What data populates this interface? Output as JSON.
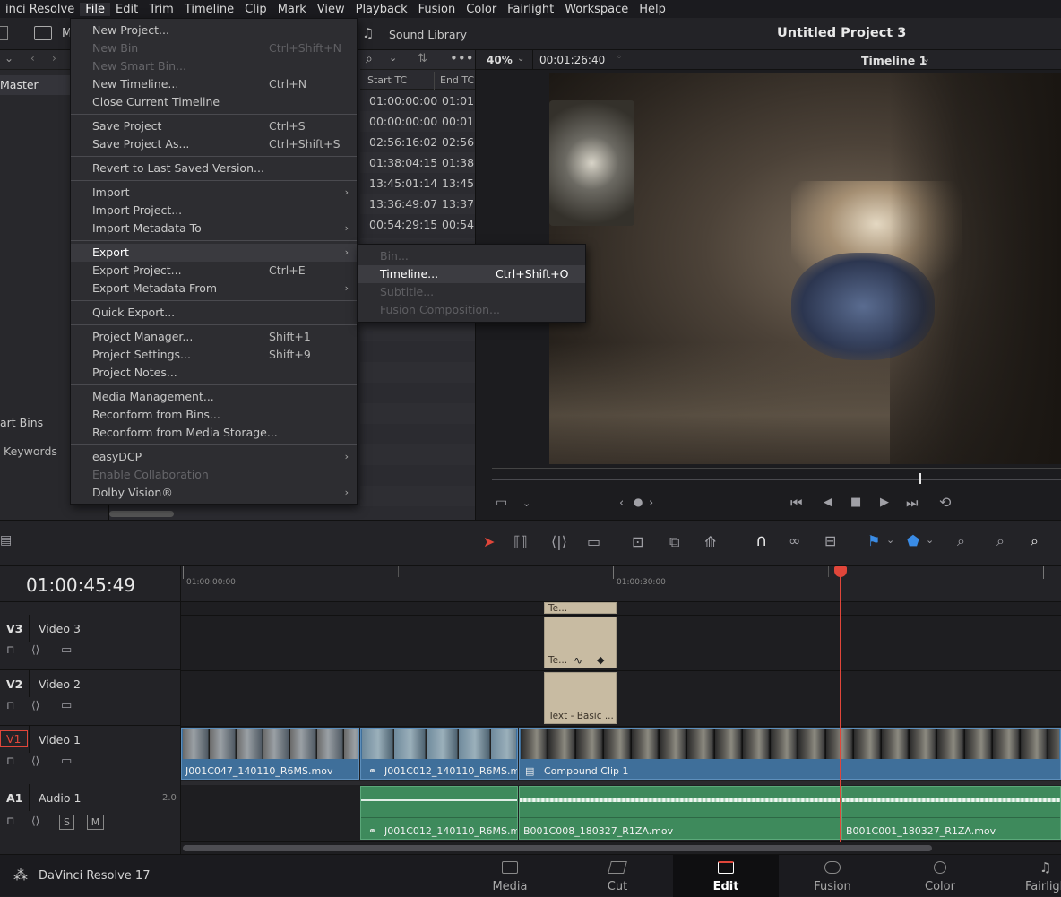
{
  "menubar": {
    "items": [
      "inci Resolve",
      "File",
      "Edit",
      "Trim",
      "Timeline",
      "Clip",
      "Mark",
      "View",
      "Playback",
      "Fusion",
      "Color",
      "Fairlight",
      "Workspace",
      "Help"
    ]
  },
  "toolbar": {
    "media_pool_label": "M",
    "sound_library": "Sound Library",
    "project_title": "Untitled Project 3"
  },
  "leftpanel": {
    "master": "Master",
    "smart_bins": "art Bins",
    "keywords": "Keywords"
  },
  "mediapool": {
    "col_start": "Start TC",
    "col_end": "End TC",
    "rows": [
      [
        "01:00:00:00",
        "01:01:"
      ],
      [
        "00:00:00:00",
        "00:01:"
      ],
      [
        "02:56:16:02",
        "02:56:"
      ],
      [
        "01:38:04:15",
        "01:38:"
      ],
      [
        "13:45:01:14",
        "13:45:"
      ],
      [
        "13:36:49:07",
        "13:37:"
      ],
      [
        "00:54:29:15",
        "00:54:"
      ]
    ]
  },
  "viewer": {
    "zoom": "40%",
    "duration": "00:01:26:40",
    "timeline_name": "Timeline 1"
  },
  "file_menu": {
    "items": [
      {
        "label": "New Project...",
        "shortcut": "",
        "disabled": false,
        "submenu": false
      },
      {
        "label": "New Bin",
        "shortcut": "Ctrl+Shift+N",
        "disabled": true,
        "submenu": false
      },
      {
        "label": "New Smart Bin...",
        "shortcut": "",
        "disabled": true,
        "submenu": false
      },
      {
        "label": "New Timeline...",
        "shortcut": "Ctrl+N",
        "disabled": false,
        "submenu": false
      },
      {
        "label": "Close Current Timeline",
        "shortcut": "",
        "disabled": false,
        "submenu": false
      },
      {
        "label": "Save Project",
        "shortcut": "Ctrl+S",
        "disabled": false,
        "submenu": false
      },
      {
        "label": "Save Project As...",
        "shortcut": "Ctrl+Shift+S",
        "disabled": false,
        "submenu": false
      },
      {
        "label": "Revert to Last Saved Version...",
        "shortcut": "",
        "disabled": false,
        "submenu": false
      },
      {
        "label": "Import",
        "shortcut": "",
        "disabled": false,
        "submenu": true
      },
      {
        "label": "Import Project...",
        "shortcut": "",
        "disabled": false,
        "submenu": false
      },
      {
        "label": "Import Metadata To",
        "shortcut": "",
        "disabled": false,
        "submenu": true
      },
      {
        "label": "Export",
        "shortcut": "",
        "disabled": false,
        "submenu": true,
        "highlighted": true
      },
      {
        "label": "Export Project...",
        "shortcut": "Ctrl+E",
        "disabled": false,
        "submenu": false
      },
      {
        "label": "Export Metadata From",
        "shortcut": "",
        "disabled": false,
        "submenu": true
      },
      {
        "label": "Quick Export...",
        "shortcut": "",
        "disabled": false,
        "submenu": false
      },
      {
        "label": "Project Manager...",
        "shortcut": "Shift+1",
        "disabled": false,
        "submenu": false
      },
      {
        "label": "Project Settings...",
        "shortcut": "Shift+9",
        "disabled": false,
        "submenu": false
      },
      {
        "label": "Project Notes...",
        "shortcut": "",
        "disabled": false,
        "submenu": false
      },
      {
        "label": "Media Management...",
        "shortcut": "",
        "disabled": false,
        "submenu": false
      },
      {
        "label": "Reconform from Bins...",
        "shortcut": "",
        "disabled": false,
        "submenu": false
      },
      {
        "label": "Reconform from Media Storage...",
        "shortcut": "",
        "disabled": false,
        "submenu": false
      },
      {
        "label": "easyDCP",
        "shortcut": "",
        "disabled": false,
        "submenu": true
      },
      {
        "label": "Enable Collaboration",
        "shortcut": "",
        "disabled": true,
        "submenu": false
      },
      {
        "label": "Dolby Vision®",
        "shortcut": "",
        "disabled": false,
        "submenu": true
      }
    ]
  },
  "export_submenu": {
    "items": [
      {
        "label": "Bin...",
        "shortcut": "",
        "disabled": true
      },
      {
        "label": "Timeline...",
        "shortcut": "Ctrl+Shift+O",
        "disabled": false,
        "highlighted": true
      },
      {
        "label": "Subtitle...",
        "shortcut": "",
        "disabled": true
      },
      {
        "label": "Fusion Composition...",
        "shortcut": "",
        "disabled": true
      }
    ]
  },
  "timeline": {
    "timecode": "01:00:45:49",
    "ruler_labels": [
      "01:00:00:00",
      "01:00:30:00"
    ],
    "tracks": {
      "v3": {
        "id": "V3",
        "name": "Video 3"
      },
      "v2": {
        "id": "V2",
        "name": "Video 2"
      },
      "v1": {
        "id": "V1",
        "name": "Video 1"
      },
      "a1": {
        "id": "A1",
        "name": "Audio 1",
        "channels": "2.0",
        "solo": "S",
        "mute": "M"
      }
    },
    "clips": {
      "text_top": "Te...",
      "text_v3": "Te...",
      "text_v2": "Text - Basic ...",
      "v1_a": "J001C047_140110_R6MS.mov",
      "v1_b": "J001C012_140110_R6MS.m...",
      "v1_c": "Compound Clip 1",
      "a1_a": "J001C012_140110_R6MS.m...",
      "a1_b": "B001C008_180327_R1ZA.mov",
      "a1_c": "B001C001_180327_R1ZA.mov"
    }
  },
  "bottombar": {
    "app": "DaVinci Resolve 17",
    "pages": [
      "Media",
      "Cut",
      "Edit",
      "Fusion",
      "Color",
      "Fairligh"
    ],
    "active_page": "Edit"
  },
  "colors": {
    "accent_red": "#e0463a",
    "video_clip": "#3f6f9a",
    "audio_clip": "#3e8a5c",
    "text_clip": "#c8bba2"
  }
}
